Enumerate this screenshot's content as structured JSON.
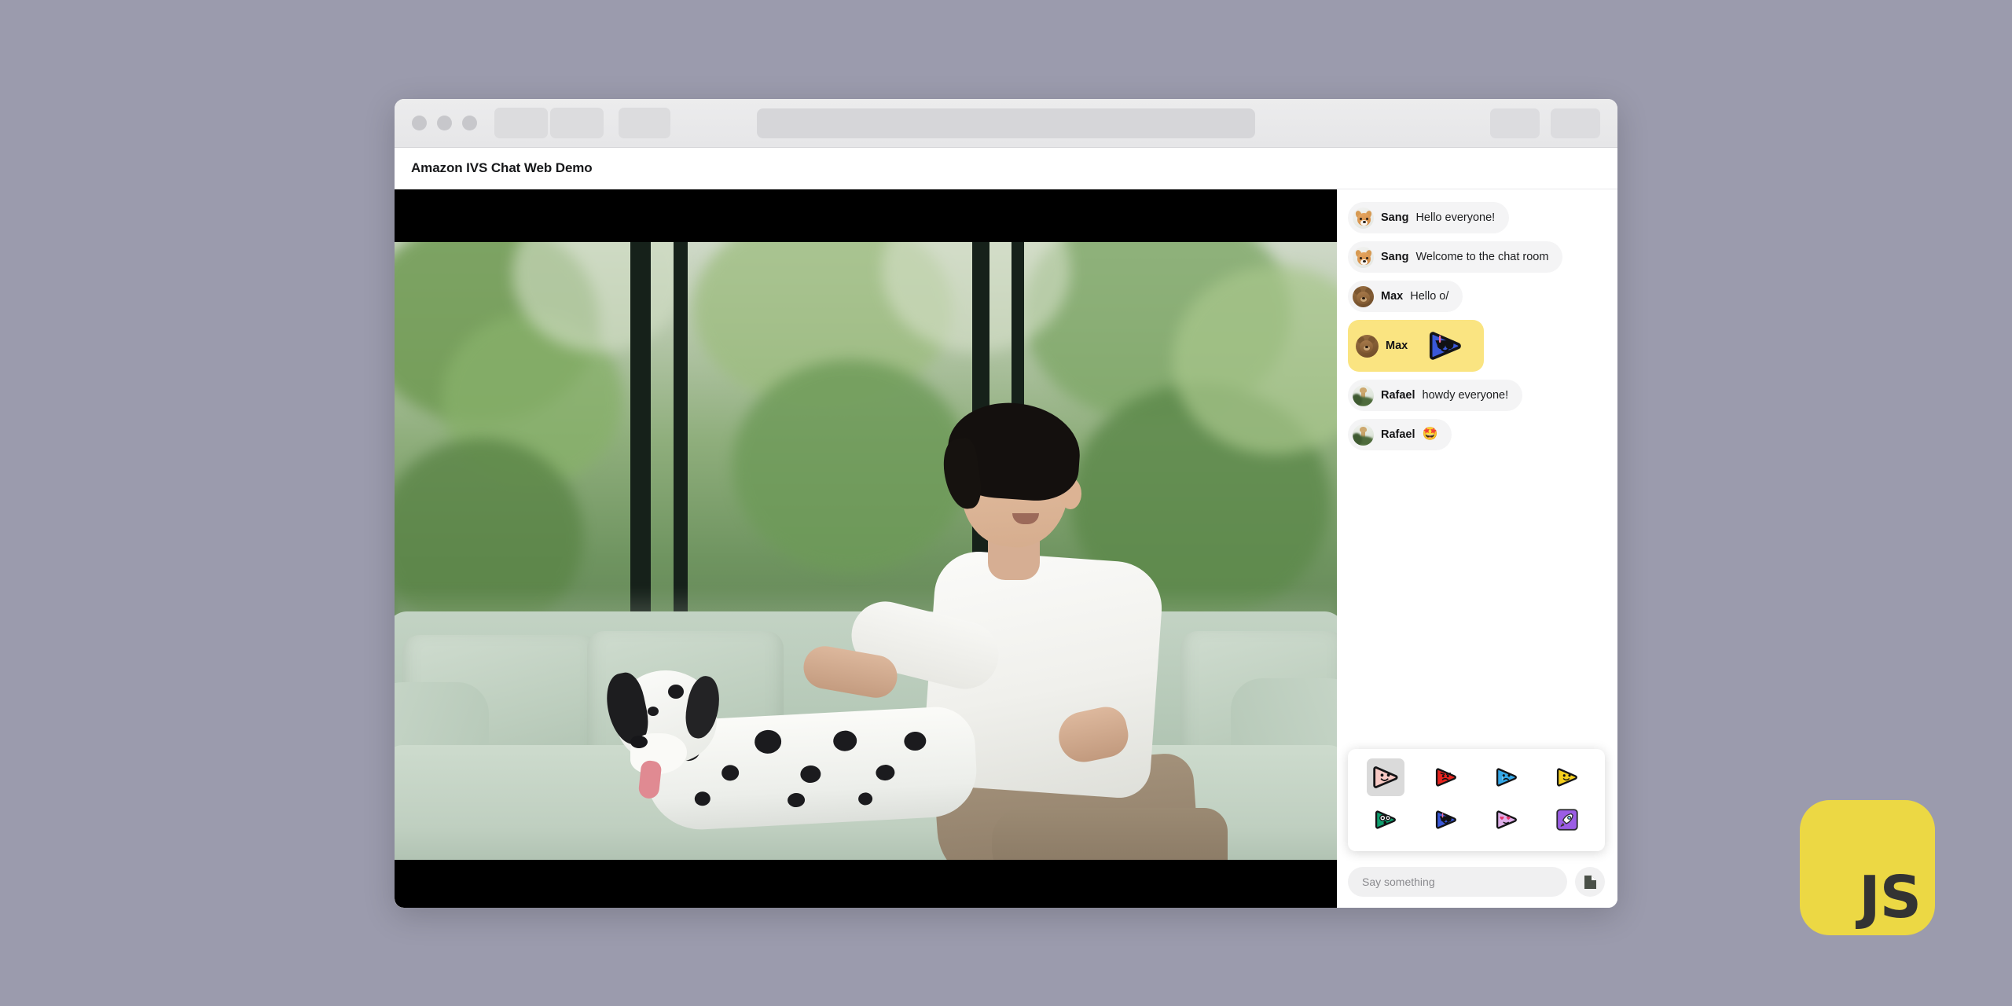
{
  "browser": {
    "traffic_lights": [
      "close",
      "minimize",
      "maximize"
    ],
    "tabs": [
      "tab-1",
      "tab-2",
      "tab-3"
    ],
    "url_value": "",
    "url_placeholder": "",
    "right_buttons": [
      "toolbar-button-1",
      "toolbar-button-2"
    ]
  },
  "header": {
    "title": "Amazon IVS Chat Web Demo"
  },
  "video": {
    "label": "live-video-stream",
    "description": "Man sitting on a light green couch with a dalmatian dog in front of large windows"
  },
  "chat": {
    "messages": [
      {
        "id": "m1",
        "avatar": "dog",
        "name": "Sang",
        "text": "Hello everyone!",
        "highlight": false,
        "sticker": null
      },
      {
        "id": "m2",
        "avatar": "dog",
        "name": "Sang",
        "text": "Welcome to the chat room",
        "highlight": false,
        "sticker": null
      },
      {
        "id": "m3",
        "avatar": "bear",
        "name": "Max",
        "text": "Hello o/",
        "highlight": false,
        "sticker": null
      },
      {
        "id": "m4",
        "avatar": "bear",
        "name": "Max",
        "text": "",
        "highlight": true,
        "sticker": "emote-blue-cool"
      },
      {
        "id": "m5",
        "avatar": "giraffe",
        "name": "Rafael",
        "text": "howdy everyone!",
        "highlight": false,
        "sticker": null
      },
      {
        "id": "m6",
        "avatar": "giraffe",
        "name": "Rafael",
        "text": "🤩",
        "highlight": false,
        "sticker": null
      }
    ],
    "highlight_color": "#fae481",
    "bubble_color": "#f4f4f5"
  },
  "emote_picker": {
    "emotes": [
      {
        "id": "e1",
        "name": "emote-pink-smile",
        "color": "#f7c9c4",
        "face": "smile",
        "selected": true
      },
      {
        "id": "e2",
        "name": "emote-red-angry",
        "color": "#e8241f",
        "face": "angry",
        "selected": false
      },
      {
        "id": "e3",
        "name": "emote-blue-sad",
        "color": "#34a8e8",
        "face": "sad",
        "selected": false
      },
      {
        "id": "e4",
        "name": "emote-yellow-smile",
        "color": "#f5cf1e",
        "face": "smile",
        "selected": false
      },
      {
        "id": "e5",
        "name": "emote-green-shock",
        "color": "#0f9f6e",
        "face": "shock",
        "selected": false
      },
      {
        "id": "e6",
        "name": "emote-blue-cool",
        "color": "#3a58d8",
        "face": "cool",
        "selected": false
      },
      {
        "id": "e7",
        "name": "emote-pink-love",
        "color": "#deaee8",
        "face": "love",
        "selected": false
      },
      {
        "id": "e8",
        "name": "emote-purple-rocket",
        "color": "#9b5de5",
        "face": "rocket",
        "selected": false
      }
    ]
  },
  "composer": {
    "input_value": "",
    "input_placeholder": "Say something",
    "sticker_button": "sticker-picker-button"
  },
  "badge": {
    "text": "JS",
    "background": "#ecd844",
    "text_color": "#333333"
  },
  "page": {
    "background": "#9b9bad"
  }
}
